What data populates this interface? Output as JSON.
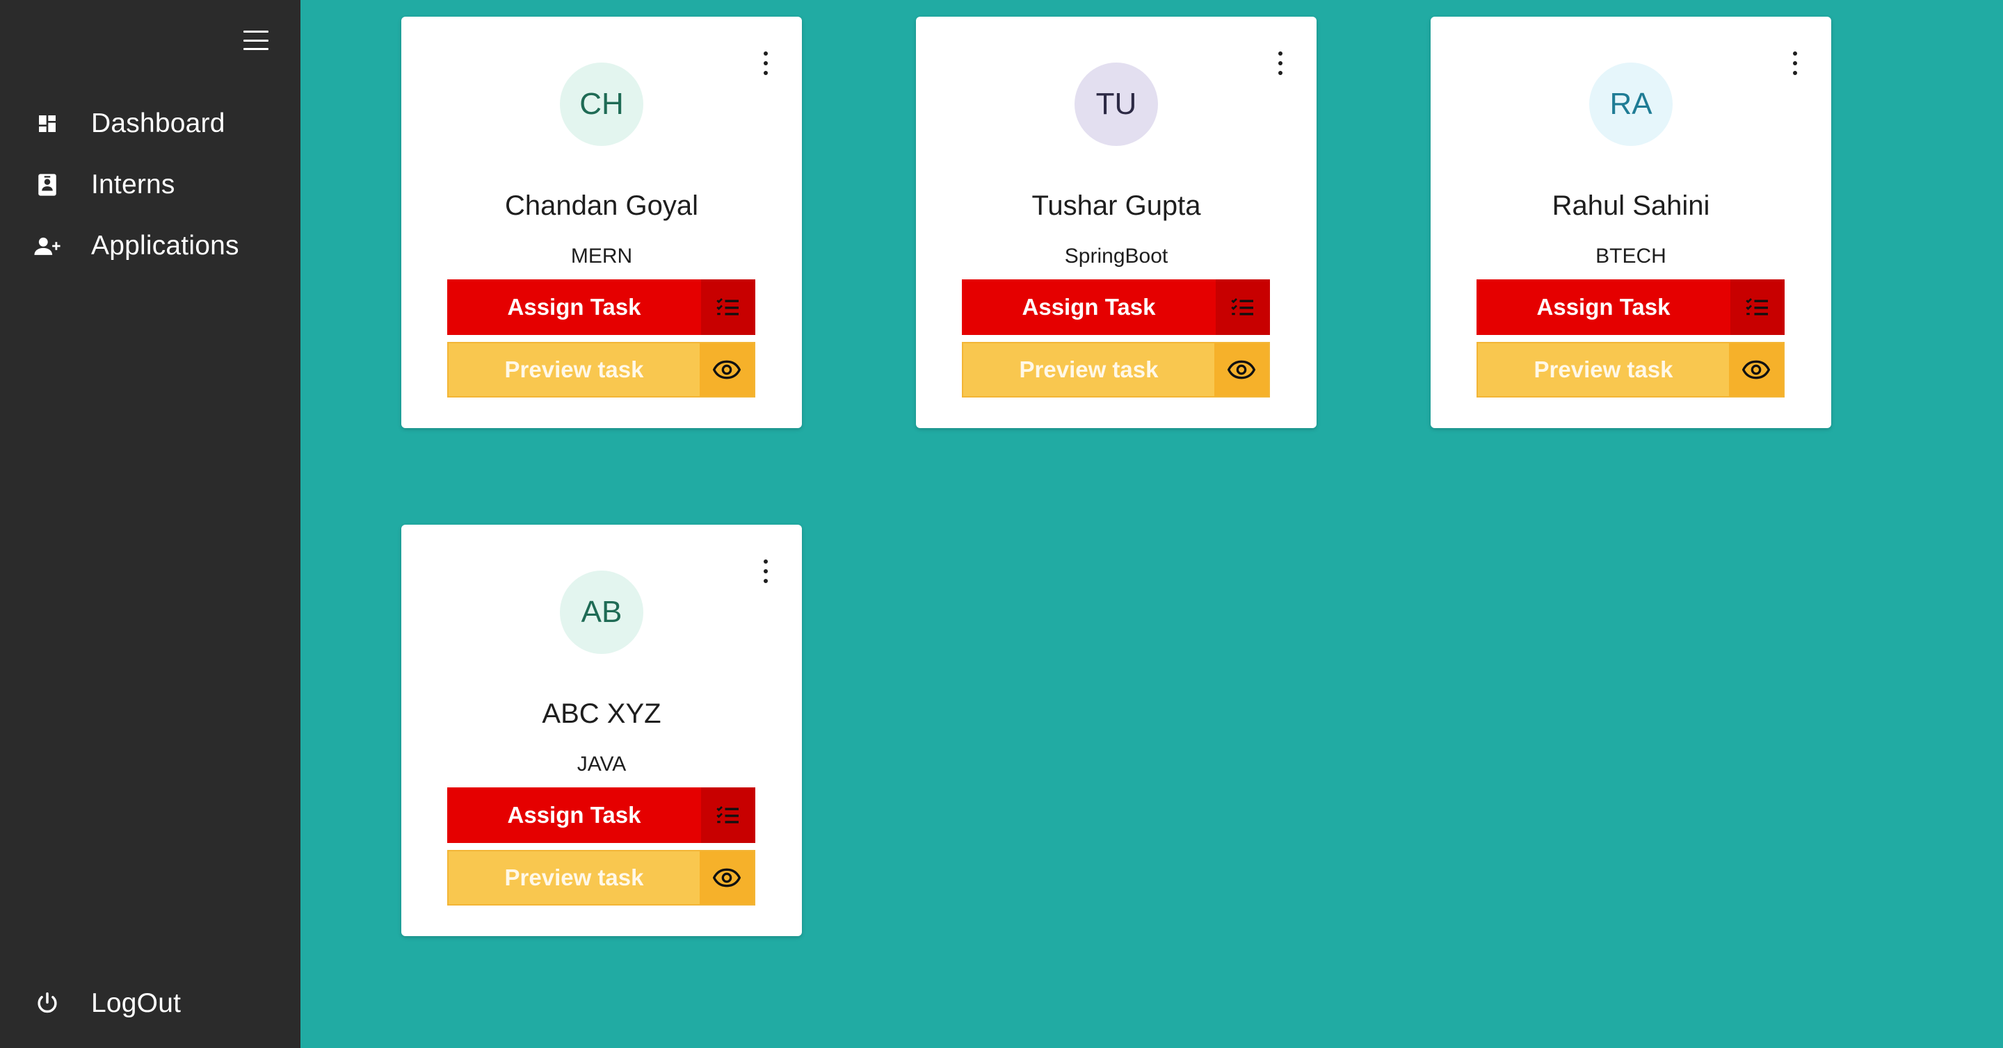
{
  "sidebar": {
    "items": [
      {
        "label": "Dashboard",
        "icon": "dashboard-icon"
      },
      {
        "label": "Interns",
        "icon": "badge-icon"
      },
      {
        "label": "Applications",
        "icon": "person-add-icon"
      }
    ],
    "logout": {
      "label": "LogOut",
      "icon": "power-icon"
    }
  },
  "colors": {
    "background": "#21aba3",
    "sidebar": "#2b2b2b",
    "assign": "#e50000",
    "preview": "#f9c74f"
  },
  "interns": [
    {
      "initials": "CH",
      "name": "Chandan Goyal",
      "track": "MERN",
      "avatar_bg": "#e3f5ef",
      "avatar_fg": "#1f6b55"
    },
    {
      "initials": "TU",
      "name": "Tushar Gupta",
      "track": "SpringBoot",
      "avatar_bg": "#e3dff0",
      "avatar_fg": "#2d2a45"
    },
    {
      "initials": "RA",
      "name": "Rahul Sahini",
      "track": "BTECH",
      "avatar_bg": "#e6f6fb",
      "avatar_fg": "#1f7c95"
    },
    {
      "initials": "AB",
      "name": "ABC XYZ",
      "track": "JAVA",
      "avatar_bg": "#e3f5ef",
      "avatar_fg": "#1f6b55"
    }
  ],
  "buttons": {
    "assign_label": "Assign Task",
    "preview_label": "Preview task"
  }
}
